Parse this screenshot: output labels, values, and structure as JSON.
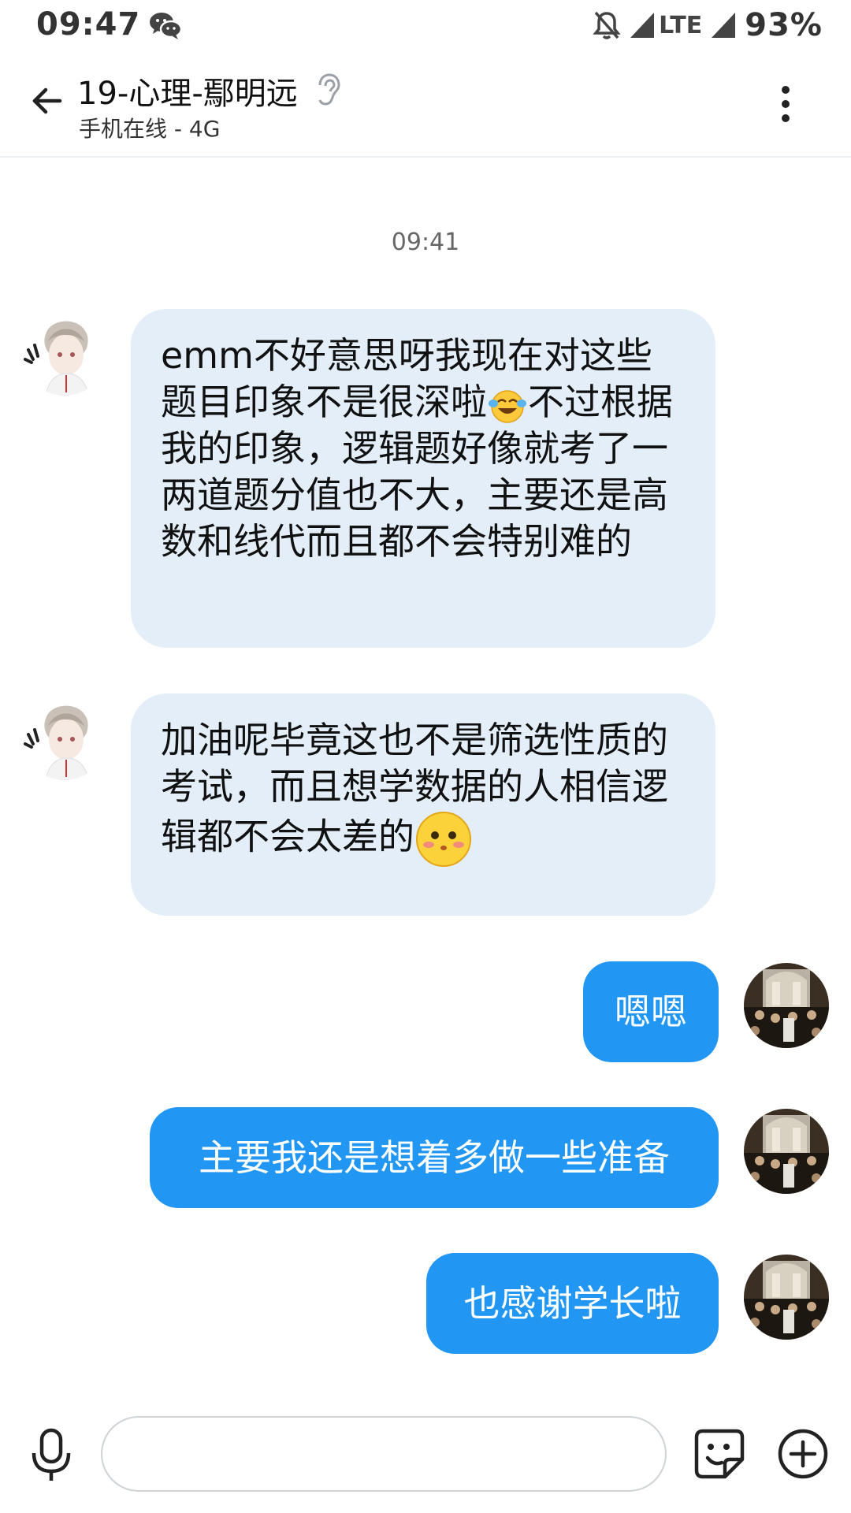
{
  "status_bar": {
    "time": "09:47",
    "network": "LTE",
    "battery": "93%"
  },
  "header": {
    "title": "19-心理-鄢明远",
    "subtitle": "手机在线 - 4G"
  },
  "conversation": {
    "timestamp": "09:41",
    "messages": [
      {
        "direction": "incoming",
        "text": "emm不好意思呀我现在对这些题目印象不是很深啦",
        "emoji": "tears-of-joy",
        "text_after": "不过根据我的印象，逻辑题好像就考了一两道题分值也不大，主要还是高数和线代而且都不会特别难的"
      },
      {
        "direction": "incoming",
        "text": "加油呢毕竟这也不是筛选性质的考试，而且想学数据的人相信逻辑都不会太差的",
        "emoji": "shy-face"
      },
      {
        "direction": "outgoing",
        "text": "嗯嗯"
      },
      {
        "direction": "outgoing",
        "text": "主要我还是想着多做一些准备"
      },
      {
        "direction": "outgoing",
        "text": "也感谢学长啦"
      }
    ]
  },
  "input_bar": {
    "value": "",
    "placeholder": ""
  },
  "colors": {
    "incoming_bubble": "#e3eef8",
    "outgoing_bubble": "#2196f3",
    "outgoing_text": "#ffffff"
  }
}
